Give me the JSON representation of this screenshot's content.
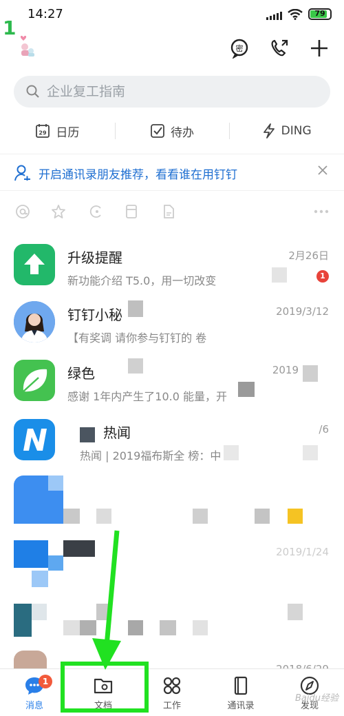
{
  "status_bar": {
    "time": "14:27",
    "battery": "79",
    "battery_level": 0.79
  },
  "step_marker": "1",
  "header": {
    "actions": [
      {
        "icon": "secret-chat-icon",
        "glyph": "密"
      },
      {
        "icon": "phone-call-icon"
      },
      {
        "icon": "plus-icon"
      }
    ]
  },
  "search": {
    "placeholder": "企业复工指南"
  },
  "shortcuts": [
    {
      "label": "日历",
      "icon": "calendar-icon",
      "day": "29"
    },
    {
      "label": "待办",
      "icon": "todo-check-icon"
    },
    {
      "label": "DING",
      "icon": "ding-lightning-icon"
    }
  ],
  "banner": {
    "text": "开启通讯录朋友推荐，看看谁在用钉钉"
  },
  "conversations": [
    {
      "name": "升级提醒",
      "subtitle": "新功能介绍                T5.0，用一切改变",
      "date": "2月26日",
      "badge": "1",
      "avatar_color": "#22b86a"
    },
    {
      "name": "钉钉小秘",
      "subtitle": "【有奖调              请你参与钉钉的                卷",
      "date": "2019/3/12",
      "avatar_color": "#3b7fd8"
    },
    {
      "name": "绿色",
      "subtitle": "感谢                 1年内产生了10.0                   能量，开",
      "date": "2019",
      "avatar_color": "#44c250"
    },
    {
      "name": "热闻",
      "subtitle": "热闻 | 2019福布斯全                     榜：中",
      "date": "/6",
      "avatar_color": "#1a8ee8"
    }
  ],
  "obscured_rows": [
    {
      "date": ""
    },
    {
      "date": "2019/1/24"
    },
    {
      "date": ""
    },
    {
      "date": "2018/6/29"
    }
  ],
  "tabbar": {
    "tabs": [
      {
        "label": "消息",
        "icon": "chat-bubble-icon",
        "badge": "1",
        "active": true
      },
      {
        "label": "文档",
        "icon": "document-folder-icon",
        "active": false
      },
      {
        "label": "工作",
        "icon": "work-grid-icon",
        "active": false
      },
      {
        "label": "通讯录",
        "icon": "contacts-book-icon",
        "active": false
      },
      {
        "label": "发现",
        "icon": "discover-compass-icon",
        "active": false
      }
    ]
  },
  "watermark": "Baidu经验",
  "colors": {
    "accent": "#2a7fe8",
    "highlight": "#21e121",
    "badge": "#f25a3b",
    "banner_text": "#1f6fd1"
  }
}
